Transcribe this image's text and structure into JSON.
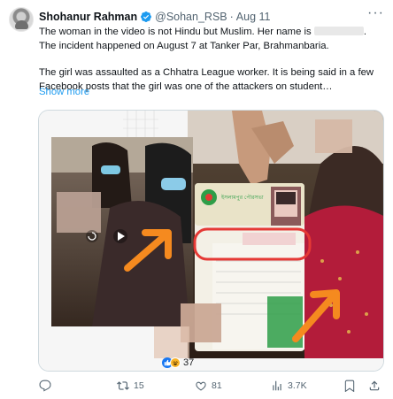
{
  "author": {
    "name": "Shohanur Rahman",
    "handle": "@Sohan_RSB",
    "separator": "·",
    "date": "Aug 11",
    "more_glyph": "···"
  },
  "tweet": {
    "paragraph1_a": "The woman in the video is not Hindu but Muslim. Her name is",
    "paragraph1_b": ". The incident happened on August 7 at Tanker Par, Brahmanbaria.",
    "paragraph2": "The girl was assaulted as a Chhatra League worker. It is being said in a few Facebook posts that the girl was one of the attackers on student…",
    "show_more": "Show more"
  },
  "media": {
    "reactions_count": "37",
    "id_card_header": "ইসলামপুর পৌরসভা",
    "colors": {
      "arrow": "#f58a1f",
      "circle": "#e53935",
      "card_green": "#2e9e48"
    }
  },
  "actions": {
    "reply_count": "",
    "retweet_count": "15",
    "like_count": "81",
    "views_count": "3.7K",
    "icons": [
      "reply-icon",
      "retweet-icon",
      "like-icon",
      "views-icon",
      "bookmark-icon",
      "share-icon"
    ]
  }
}
